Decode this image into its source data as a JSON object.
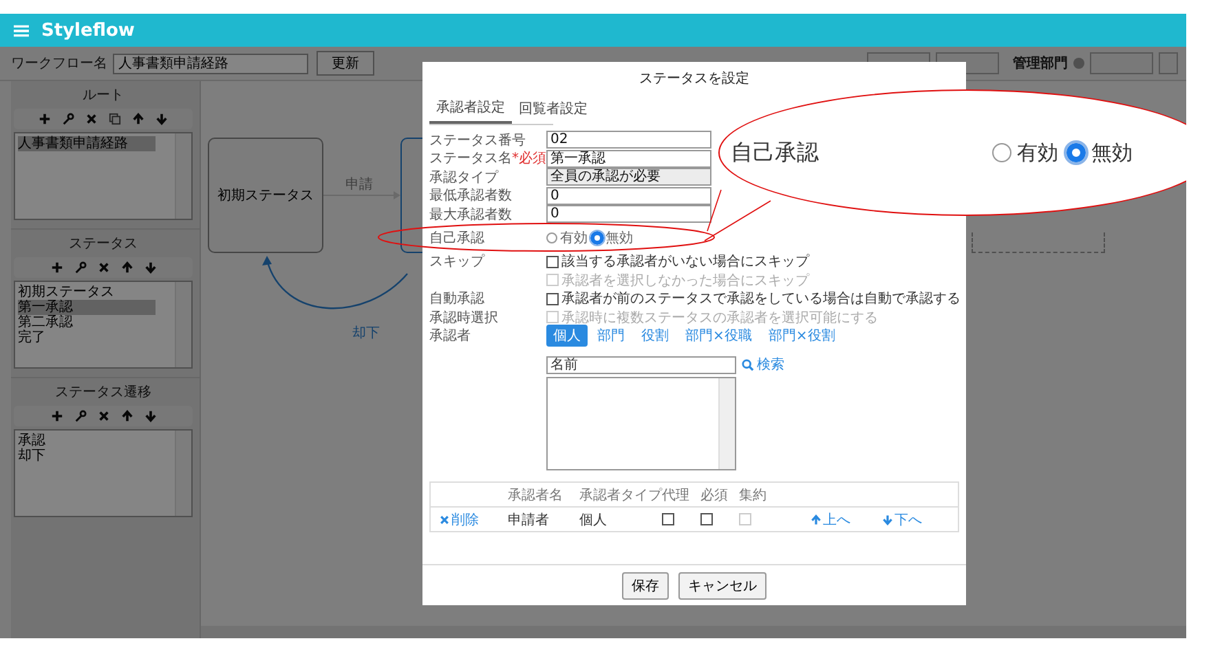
{
  "app": {
    "title": "Styleflow"
  },
  "toolbar": {
    "workflow_label": "ワークフロー名",
    "workflow_name": "人事書類申請経路",
    "update_button": "更新",
    "department_label": "管理部門"
  },
  "sidebar": {
    "sections": [
      {
        "title": "ルート",
        "copy_tool": true,
        "items": [
          {
            "label": "人事書類申請経路",
            "selected": true
          }
        ]
      },
      {
        "title": "ステータス",
        "copy_tool": false,
        "items": [
          {
            "label": "初期ステータス",
            "selected": false
          },
          {
            "label": "第一承認",
            "selected": true
          },
          {
            "label": "第二承認",
            "selected": false
          },
          {
            "label": "完了",
            "selected": false
          }
        ]
      },
      {
        "title": "ステータス遷移",
        "copy_tool": false,
        "items": [
          {
            "label": "承認",
            "selected": false
          },
          {
            "label": "却下",
            "selected": false
          }
        ]
      }
    ]
  },
  "canvas": {
    "nodes": [
      {
        "label": "初期ステータス"
      }
    ],
    "edges": [
      {
        "label": "申請"
      },
      {
        "label": "却下"
      }
    ]
  },
  "dialog": {
    "title": "ステータスを設定",
    "tabs": [
      {
        "label": "承認者設定",
        "selected": true
      },
      {
        "label": "回覧者設定",
        "selected": false
      }
    ],
    "fields": [
      {
        "label": "ステータス番号",
        "value": "02",
        "kind": "text"
      },
      {
        "label": "ステータス名",
        "required_note": "*必須",
        "value": "第一承認",
        "kind": "text"
      },
      {
        "label": "承認タイプ",
        "value": "全員の承認が必要",
        "kind": "select"
      },
      {
        "label": "最低承認者数",
        "value": "0",
        "kind": "text"
      },
      {
        "label": "最大承認者数",
        "value": "0",
        "kind": "text"
      }
    ],
    "self_approval": {
      "label": "自己承認",
      "options": [
        {
          "label": "有効",
          "selected": false
        },
        {
          "label": "無効",
          "selected": true
        }
      ]
    },
    "option_rows": [
      {
        "label": "スキップ",
        "checks": [
          {
            "text": "該当する承認者がいない場合にスキップ",
            "checked": false,
            "disabled": false
          },
          {
            "text": "承認者を選択しなかった場合にスキップ",
            "checked": false,
            "disabled": true
          }
        ]
      },
      {
        "label": "自動承認",
        "checks": [
          {
            "text": "承認者が前のステータスで承認をしている場合は自動で承認する",
            "checked": false,
            "disabled": false
          }
        ]
      },
      {
        "label": "承認時選択",
        "checks": [
          {
            "text": "承認時に複数ステータスの承認者を選択可能にする",
            "checked": false,
            "disabled": true
          }
        ]
      }
    ],
    "approver": {
      "label": "承認者",
      "types": [
        {
          "label": "個人",
          "selected": true
        },
        {
          "label": "部門",
          "selected": false
        },
        {
          "label": "役割",
          "selected": false
        },
        {
          "label": "部門×役職",
          "selected": false
        },
        {
          "label": "部門×役割",
          "selected": false
        }
      ],
      "search": {
        "placeholder": "名前"
      },
      "search_link": "検索"
    },
    "table": {
      "columns": [
        "承認者名",
        "承認者タイプ",
        "代理",
        "必須",
        "集約"
      ],
      "rows": [
        {
          "delete": "削除",
          "name": "申請者",
          "type": "個人",
          "flags": [
            {
              "checked": false,
              "disabled": false
            },
            {
              "checked": false,
              "disabled": false
            },
            {
              "checked": false,
              "disabled": true
            }
          ],
          "up": "上へ",
          "down": "下へ"
        }
      ]
    },
    "buttons": [
      {
        "label": "保存"
      },
      {
        "label": "キャンセル"
      }
    ]
  },
  "callout": {
    "label": "自己承認",
    "options": [
      {
        "label": "有効",
        "selected": false
      },
      {
        "label": "無効",
        "selected": true
      }
    ]
  }
}
